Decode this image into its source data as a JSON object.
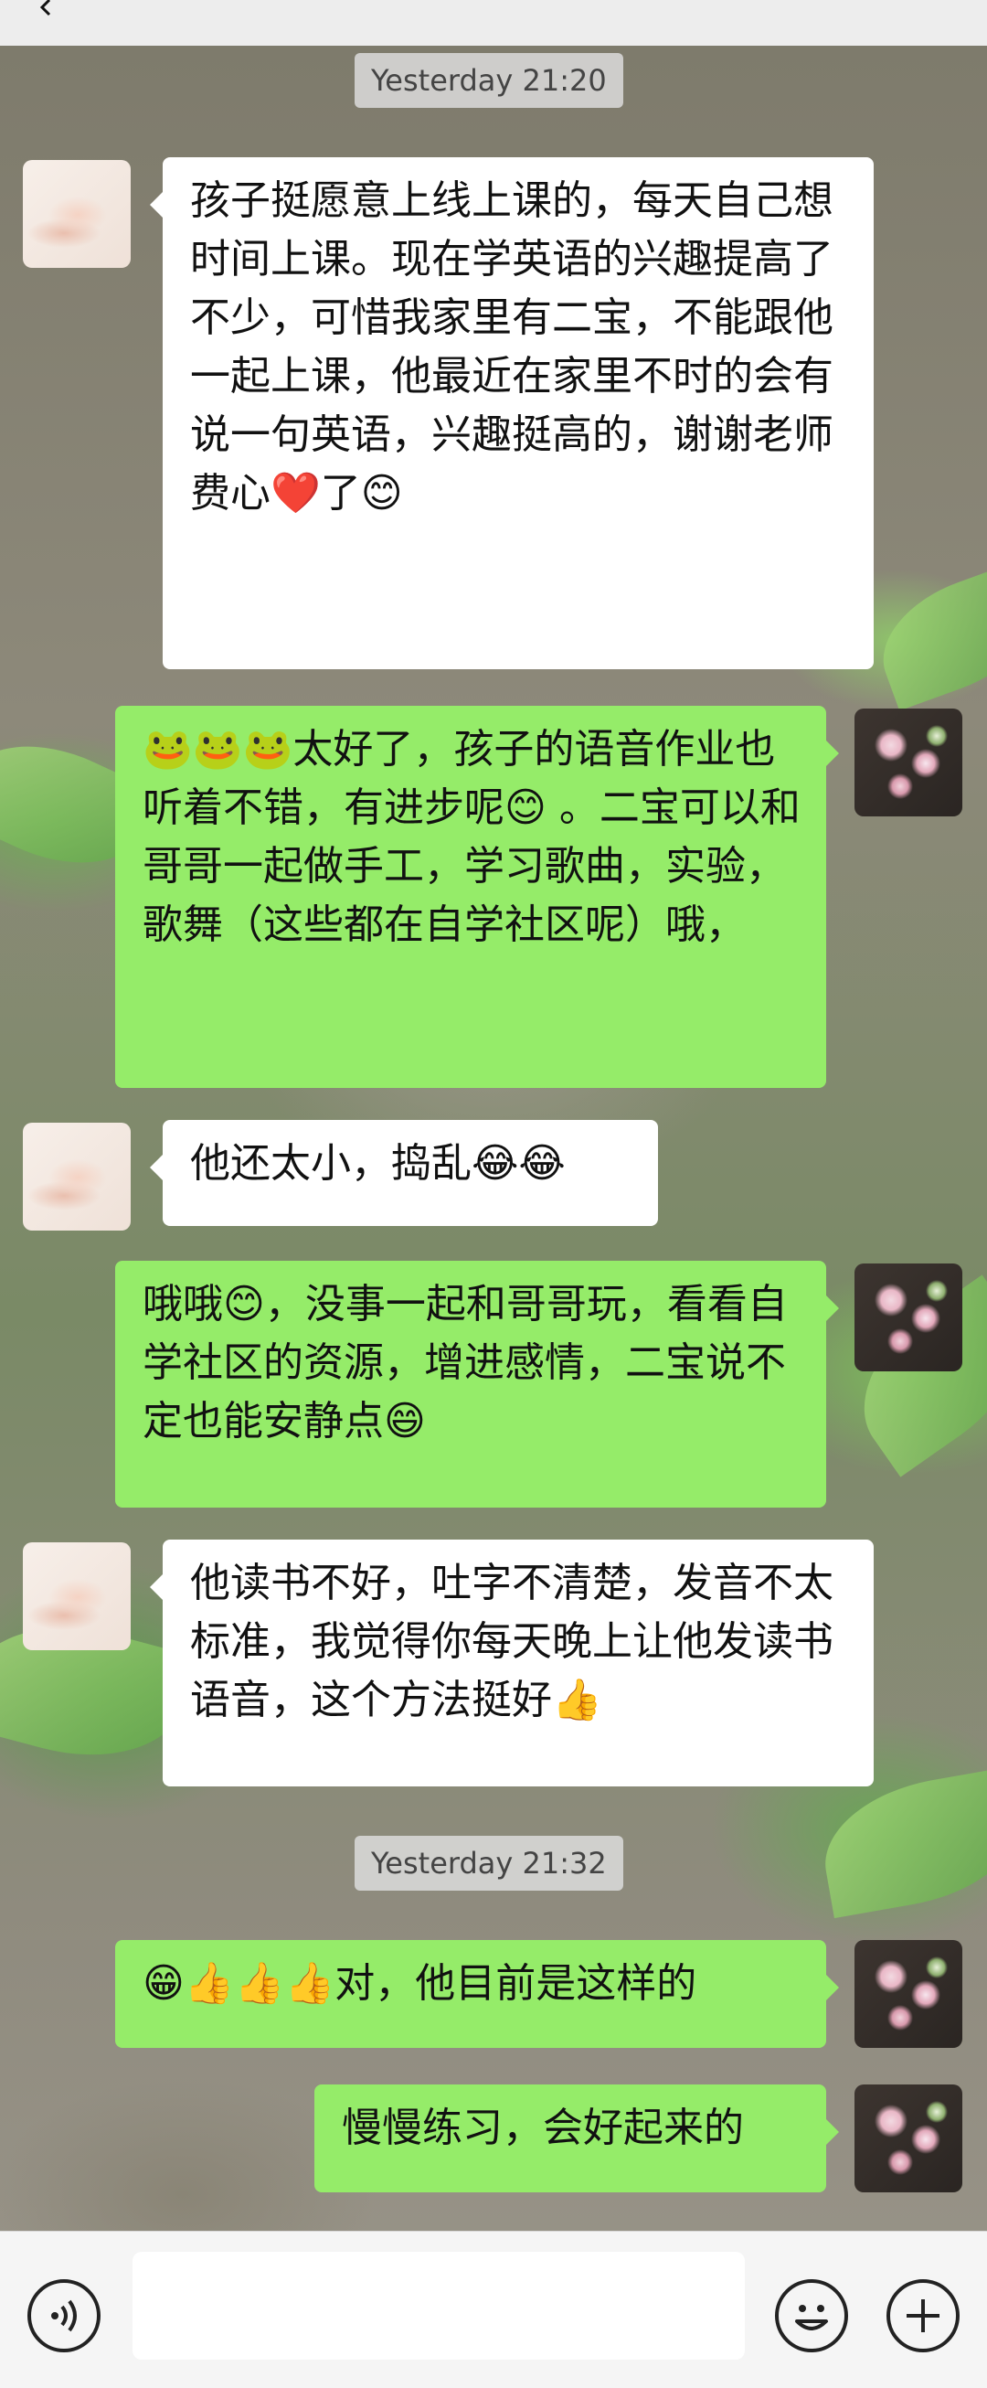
{
  "timestamps": {
    "first": "Yesterday 21:20",
    "second": "Yesterday 21:32"
  },
  "messages": [
    {
      "sender": "other",
      "text": "孩子挺愿意上线上课的，每天自己想时间上课。现在学英语的兴趣提高了不少，可惜我家里有二宝，不能跟他一起上课，他最近在家里不时的会有说一句英语，兴趣挺高的，谢谢老师费心❤️了😊"
    },
    {
      "sender": "me",
      "text": "🐸🐸🐸太好了，孩子的语音作业也听着不错，有进步呢😊 。二宝可以和哥哥一起做手工，学习歌曲，实验，歌舞（这些都在自学社区呢）哦，"
    },
    {
      "sender": "other",
      "text": "他还太小，捣乱😂😂"
    },
    {
      "sender": "me",
      "text": "哦哦😊，没事一起和哥哥玩，看看自学社区的资源，增进感情，二宝说不定也能安静点😄"
    },
    {
      "sender": "other",
      "text": "他读书不好，吐字不清楚，发音不太标准，我觉得你每天晚上让他发读书语音，这个方法挺好👍"
    },
    {
      "sender": "me",
      "text": "😁👍👍👍对，他目前是这样的"
    },
    {
      "sender": "me",
      "text": "慢慢练习，会好起来的"
    }
  ],
  "input": {
    "placeholder": ""
  }
}
